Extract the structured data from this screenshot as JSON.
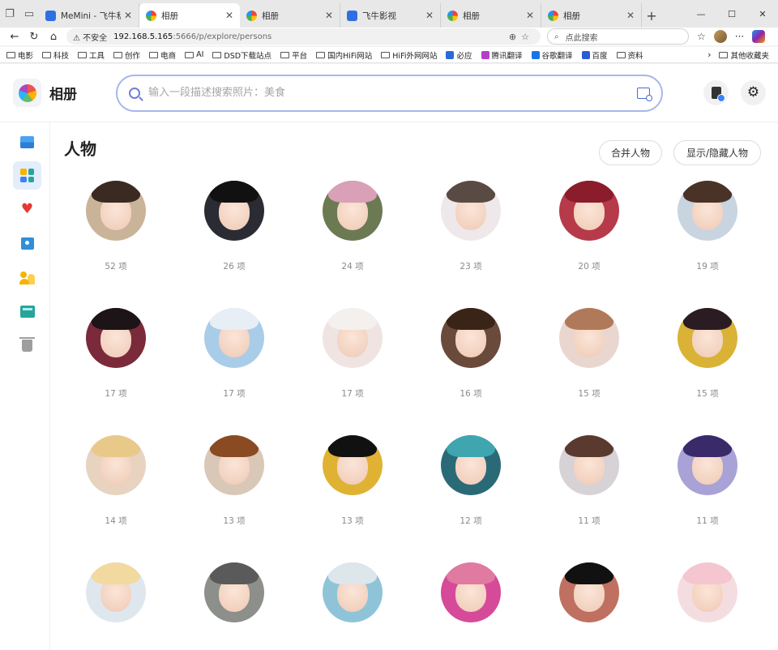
{
  "browser": {
    "tabs": [
      {
        "title": "MeMini - 飞牛私有云",
        "favicon": "memini-icon",
        "active": false
      },
      {
        "title": "相册",
        "favicon": "photos-icon",
        "active": true
      },
      {
        "title": "相册",
        "favicon": "photos-icon",
        "active": false
      },
      {
        "title": "飞牛影视",
        "favicon": "video-icon",
        "active": false
      },
      {
        "title": "相册",
        "favicon": "photos-icon",
        "active": false
      },
      {
        "title": "相册",
        "favicon": "photos-icon",
        "active": false
      }
    ],
    "address": {
      "security_label": "不安全",
      "url_host": "192.168.5.165",
      "url_rest": ":5666/p/explore/persons"
    },
    "search_placeholder": "点此搜索",
    "bookmarks": [
      {
        "label": "电影",
        "type": "folder"
      },
      {
        "label": "科技",
        "type": "folder"
      },
      {
        "label": "工具",
        "type": "folder"
      },
      {
        "label": "创作",
        "type": "folder"
      },
      {
        "label": "电商",
        "type": "folder"
      },
      {
        "label": "AI",
        "type": "folder"
      },
      {
        "label": "DSD下载站点",
        "type": "folder"
      },
      {
        "label": "平台",
        "type": "folder"
      },
      {
        "label": "国内HiFi网站",
        "type": "folder"
      },
      {
        "label": "HiFi外网网站",
        "type": "folder"
      },
      {
        "label": "必应",
        "type": "link"
      },
      {
        "label": "腾讯翻译",
        "type": "link"
      },
      {
        "label": "谷歌翻译",
        "type": "link"
      },
      {
        "label": "百度",
        "type": "link"
      },
      {
        "label": "资料",
        "type": "folder"
      }
    ],
    "other_bookmarks": "其他收藏夹"
  },
  "app": {
    "title": "相册",
    "search_placeholder": "输入一段描述搜索照片：美食",
    "accent": "#a9b6ee"
  },
  "sidebar": [
    {
      "icon": "photo-icon",
      "active": false
    },
    {
      "icon": "explore-icon",
      "active": true
    },
    {
      "icon": "heart-icon",
      "active": false
    },
    {
      "icon": "album-icon",
      "active": false
    },
    {
      "icon": "people-icon",
      "active": false
    },
    {
      "icon": "shared-album-icon",
      "active": false
    },
    {
      "icon": "trash-icon",
      "active": false
    }
  ],
  "page": {
    "title": "人物",
    "merge_button": "合并人物",
    "toggle_button": "显示/隐藏人物"
  },
  "persons": [
    {
      "count": "52 项",
      "hair": "#3a2a22",
      "bg": "#c9b49a"
    },
    {
      "count": "26 项",
      "hair": "#111111",
      "bg": "#2b2b33"
    },
    {
      "count": "24 项",
      "hair": "#d9a0b8",
      "bg": "#6b7a52"
    },
    {
      "count": "23 项",
      "hair": "#5a4a44",
      "bg": "#efe8ea"
    },
    {
      "count": "20 项",
      "hair": "#8a1c2c",
      "bg": "#b63a4a"
    },
    {
      "count": "19 项",
      "hair": "#4a3226",
      "bg": "#c8d4e0"
    },
    {
      "count": "17 项",
      "hair": "#1d1417",
      "bg": "#7a2a3a"
    },
    {
      "count": "17 项",
      "hair": "#e8eef5",
      "bg": "#a9cde8"
    },
    {
      "count": "17 项",
      "hair": "#f4f0ee",
      "bg": "#efe4e2"
    },
    {
      "count": "16 项",
      "hair": "#3a2418",
      "bg": "#6a4a3a"
    },
    {
      "count": "15 项",
      "hair": "#b07a5a",
      "bg": "#e9d7cf"
    },
    {
      "count": "15 项",
      "hair": "#2a1c22",
      "bg": "#d9b236"
    },
    {
      "count": "14 项",
      "hair": "#e8c98a",
      "bg": "#e7d3c0"
    },
    {
      "count": "13 项",
      "hair": "#8a4a22",
      "bg": "#d9c7b8"
    },
    {
      "count": "13 项",
      "hair": "#111111",
      "bg": "#e0b234"
    },
    {
      "count": "12 项",
      "hair": "#3fa6b0",
      "bg": "#2a6a76"
    },
    {
      "count": "11 项",
      "hair": "#5a3a2e",
      "bg": "#d7d2d6"
    },
    {
      "count": "11 项",
      "hair": "#3a2a6a",
      "bg": "#a8a2d6"
    },
    {
      "count": "",
      "hair": "#f1d9a0",
      "bg": "#dfe7ee"
    },
    {
      "count": "",
      "hair": "#5a5a5a",
      "bg": "#8c8f8a"
    },
    {
      "count": "",
      "hair": "#dde6ea",
      "bg": "#8fc4d8"
    },
    {
      "count": "",
      "hair": "#e07aa0",
      "bg": "#d64a9a"
    },
    {
      "count": "",
      "hair": "#111111",
      "bg": "#c07060"
    },
    {
      "count": "",
      "hair": "#f5c6cf",
      "bg": "#f4dde0"
    }
  ]
}
